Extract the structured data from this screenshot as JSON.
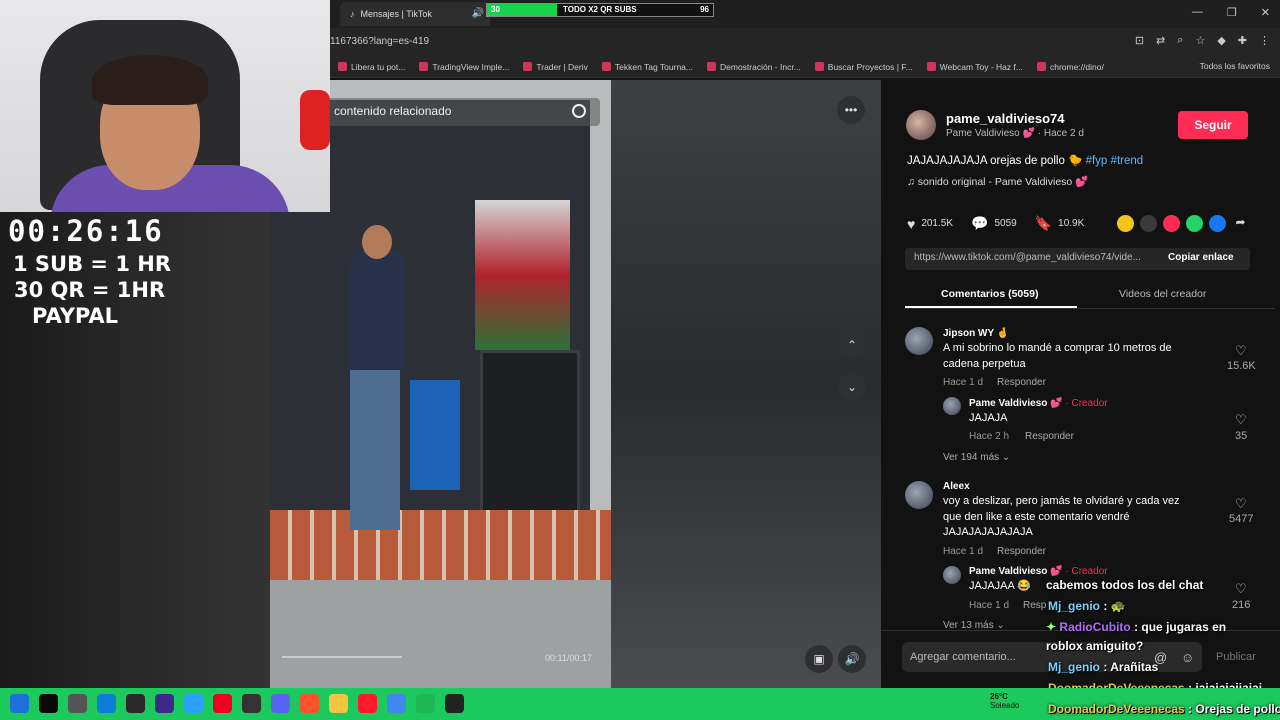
{
  "browser": {
    "tab_title": "Mensajes | TikTok",
    "url": "1167366?lang=es-419",
    "bookmarks": [
      "Libera tu pot...",
      "TradingView Imple...",
      "Trader | Deriv",
      "Tekken Tag Tourna...",
      "Demostración - Incr...",
      "Buscar Proyectos | F...",
      "Webcam Toy - Haz f...",
      "chrome://dino/"
    ],
    "all_favorites": "Todos los favoritos"
  },
  "sub_goal": {
    "left_value": "30",
    "label": "TODO X2 QR SUBS",
    "right_value": "96",
    "progress": 0.31
  },
  "stream": {
    "timer": "00:26:16",
    "promo1": "1 SUB = 1 HR",
    "promo2": "30 QR = 1HR",
    "promo3": "PAYPAL"
  },
  "video": {
    "search_placeholder": "contenido relacionado",
    "time": "00:11/00:17"
  },
  "post": {
    "username": "pame_valdivieso74",
    "nickname": "Pame Valdivieso 💕 · Hace 2 d",
    "follow_label": "Seguir",
    "caption_text": "JAJAJAJAJAJA orejas de pollo 🐤 ",
    "hashtag1": "#fyp",
    "hashtag2": "#trend",
    "music": "♫  sonido original - Pame Valdivieso 💕",
    "likes": "201.5K",
    "comments": "5059",
    "saves": "10.9K",
    "link": "https://www.tiktok.com/@pame_valdivieso74/vide...",
    "copy_label": "Copiar enlace"
  },
  "tabs": {
    "comments": "Comentarios (5059)",
    "videos": "Videos del creador"
  },
  "comments": [
    {
      "author": "Jipson WY 🤞",
      "text1": "A mi sobrino lo mandé a comprar 10 metros de",
      "text2": "cadena perpetua",
      "meta": "Hace 1 d",
      "reply": "Responder",
      "likes": "15.6K",
      "sub_author": "Pame Valdivieso 💕",
      "sub_badge": "· Creador",
      "sub_text": "JAJAJA",
      "sub_meta": "Hace 2 h",
      "sub_reply": "Responder",
      "sub_likes": "35",
      "more": "Ver 194 más ⌄"
    },
    {
      "author": "Aleex",
      "text1": "voy a deslizar, pero jamás te olvidaré y cada vez",
      "text2": "que den like a este comentario vendré",
      "text3": "JAJAJAJAJAJAJA",
      "meta": "Hace 1 d",
      "reply": "Responder",
      "likes": "5477",
      "sub_author": "Pame Valdivieso 💕",
      "sub_badge": "· Creador",
      "sub_text": "JAJAJAA 😂",
      "sub_meta": "Hace 1 d",
      "sub_reply": "Resp",
      "sub_likes": "216",
      "more": "Ver 13 más ⌄"
    }
  ],
  "add_comment": {
    "placeholder": "Agregar comentario...",
    "publish": "Publicar"
  },
  "chat": [
    {
      "user": "",
      "text": "cabemos todos los del chat"
    },
    {
      "user": "Mj_genio",
      "text": " : 🐢"
    },
    {
      "user": "RadioCubito",
      "text": " : que jugaras en"
    },
    {
      "user": "",
      "text": "roblox amiguito?"
    },
    {
      "user": "Mj_genio",
      "text": " : Arañitas"
    },
    {
      "user": "DoomadorDeVeeenecas",
      "text": " : jajajajajjajaj"
    },
    {
      "user": "DoomadorDeVeeenecas",
      "text": " : Orejas de pollo"
    }
  ],
  "taskbar": {
    "temp": "26°C",
    "weather": "Soleado"
  }
}
